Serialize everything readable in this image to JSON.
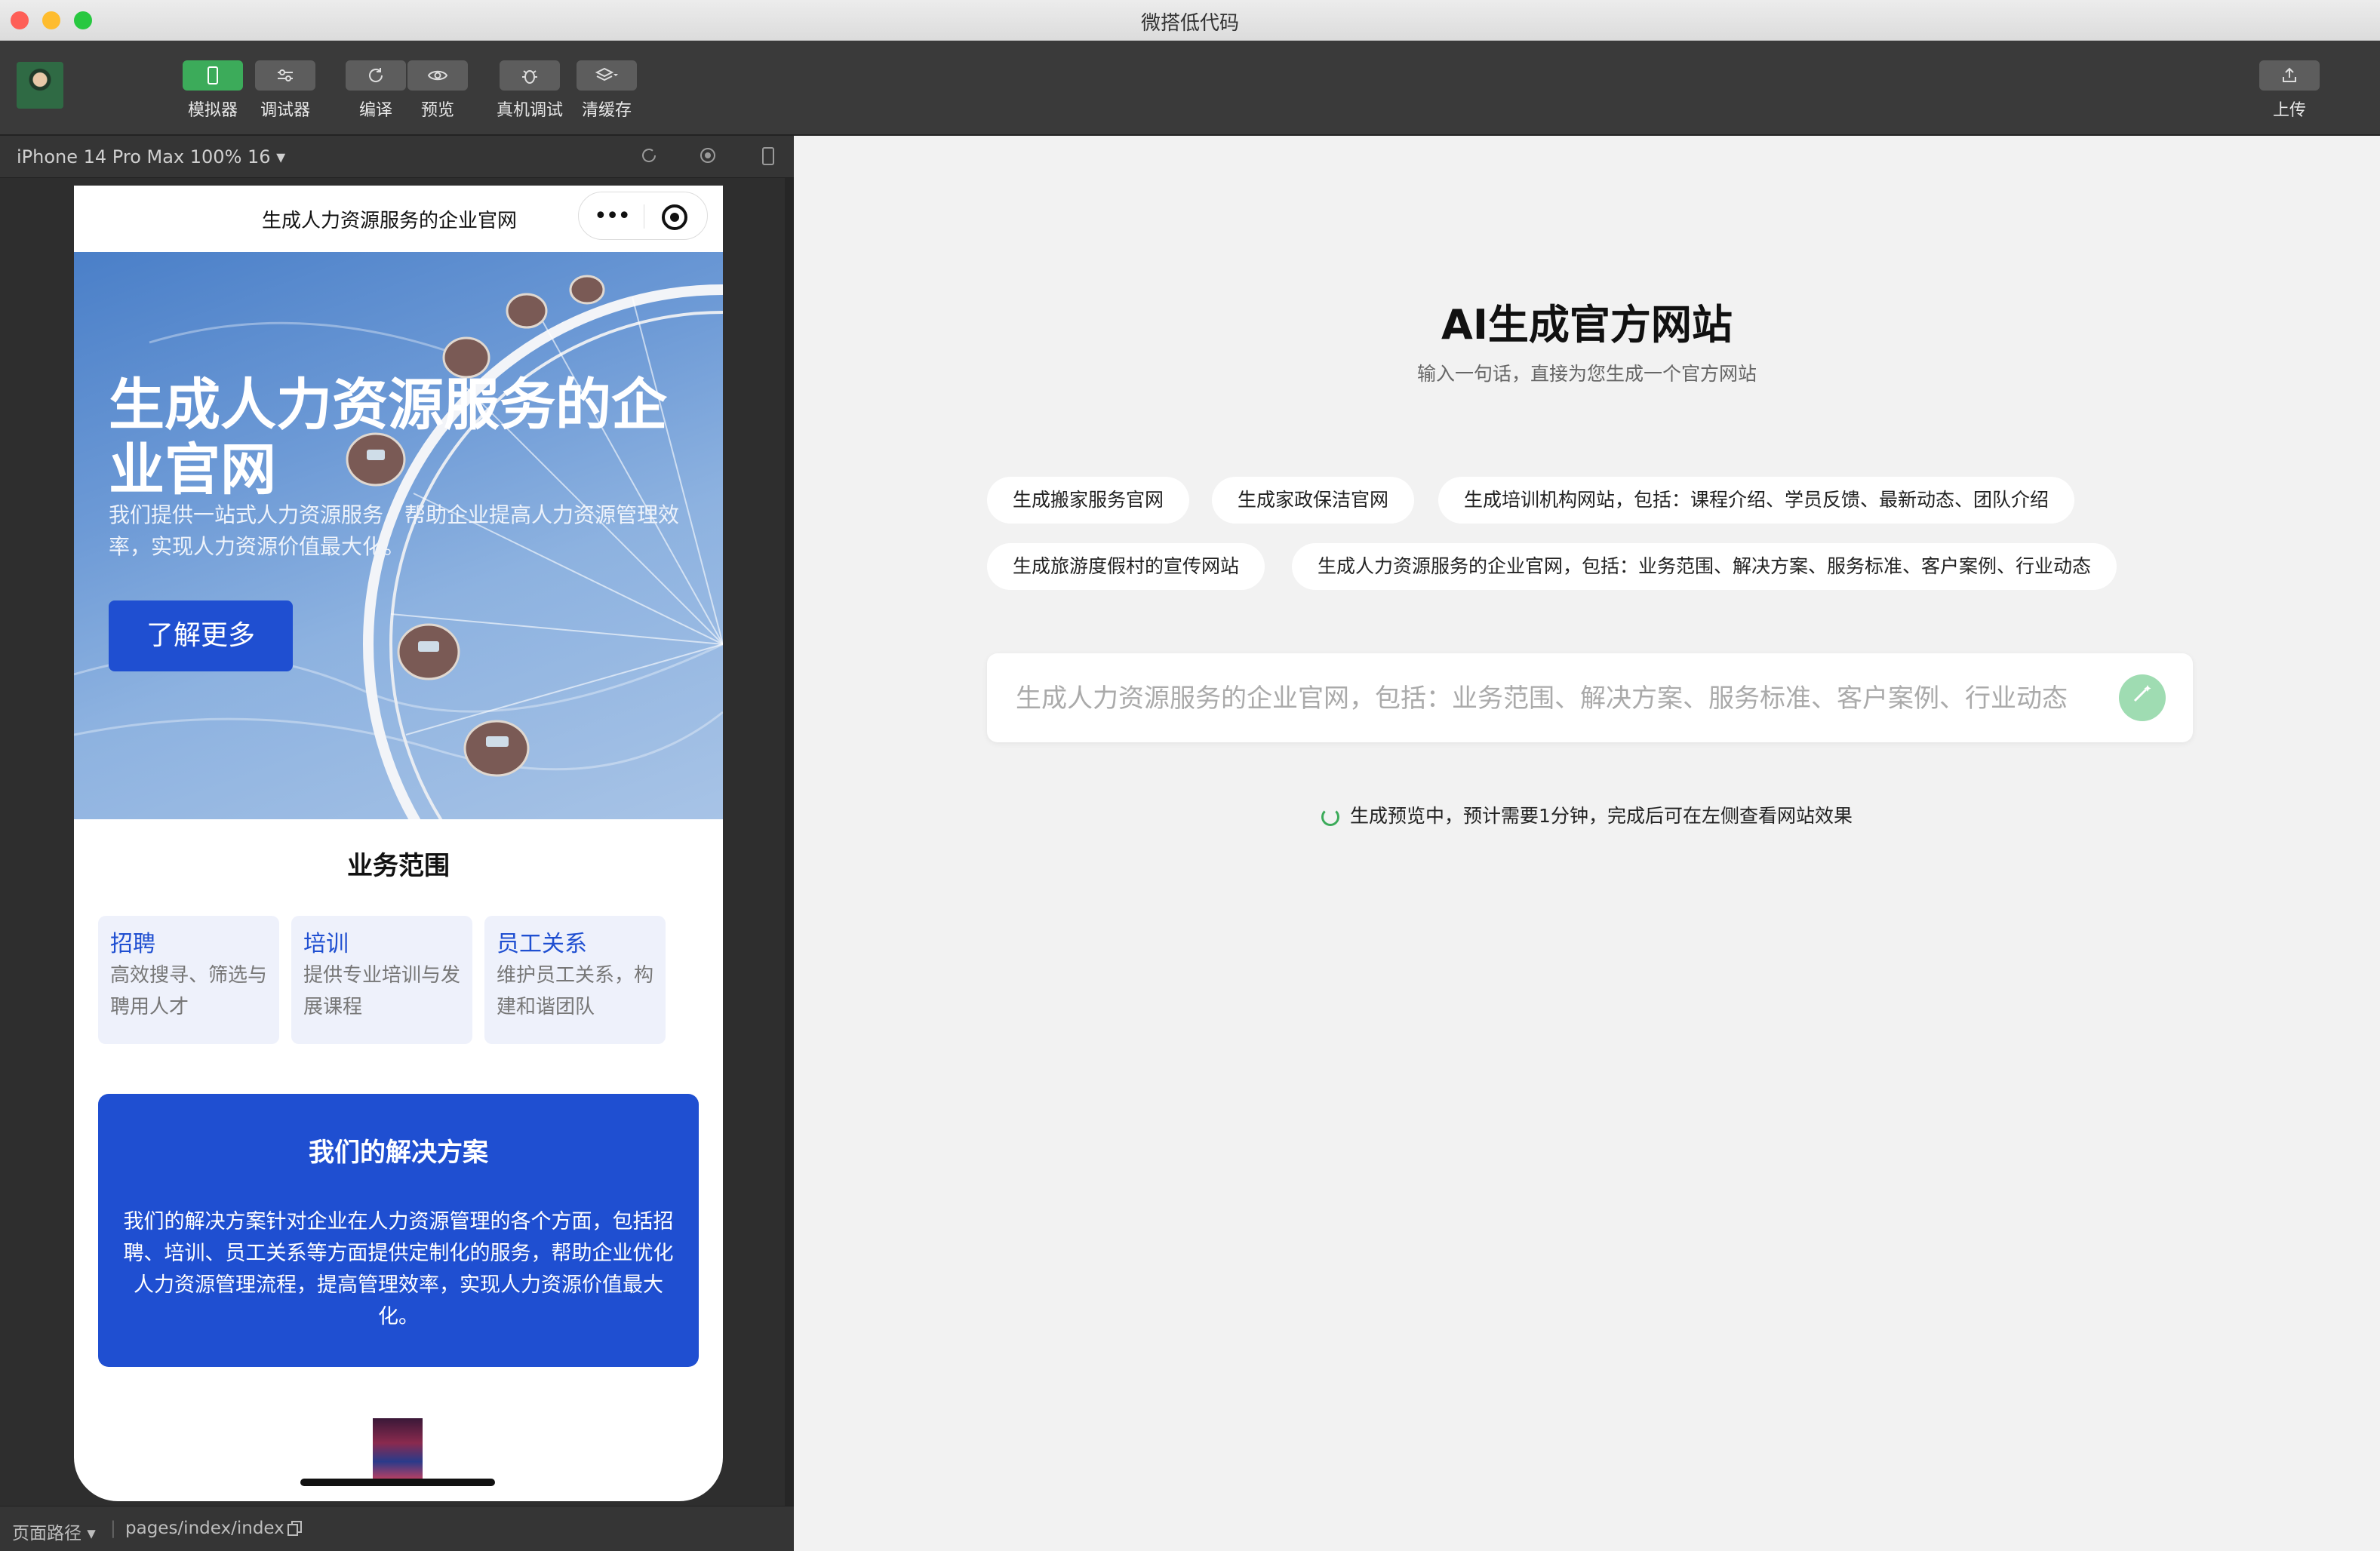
{
  "window": {
    "title": "微搭低代码"
  },
  "toolbar": {
    "simulator": "模拟器",
    "debugger": "调试器",
    "compile": "编译",
    "preview": "预览",
    "device_debug": "真机调试",
    "clear_cache": "清缓存",
    "upload": "上传"
  },
  "device": {
    "label": "iPhone 14 Pro Max 100% 16 ▾"
  },
  "statusbar": {
    "path_label": "页面路径 ▾",
    "path_value": "pages/index/index"
  },
  "phone": {
    "nav_title": "生成人力资源服务的企业官网",
    "hero": {
      "title": "生成人力资源服务的企业官网",
      "description": "我们提供一站式人力资源服务，帮助企业提高人力资源管理效率，实现人力资源价值最大化。",
      "button": "了解更多"
    },
    "section_title": "业务范围",
    "cards": [
      {
        "title": "招聘",
        "desc": "高效搜寻、筛选与聘用人才"
      },
      {
        "title": "培训",
        "desc": "提供专业培训与发展课程"
      },
      {
        "title": "员工关系",
        "desc": "维护员工关系，构建和谐团队"
      }
    ],
    "solution": {
      "title": "我们的解决方案",
      "text": "我们的解决方案针对企业在人力资源管理的各个方面，包括招聘、培训、员工关系等方面提供定制化的服务，帮助企业优化人力资源管理流程，提高管理效率，实现人力资源价值最大化。"
    }
  },
  "generator": {
    "title": "AI生成官方网站",
    "subtitle": "输入一句话，直接为您生成一个官方网站",
    "chips": [
      "生成搬家服务官网",
      "生成家政保洁官网",
      "生成培训机构网站，包括：课程介绍、学员反馈、最新动态、团队介绍",
      "生成旅游度假村的宣传网站",
      "生成人力资源服务的企业官网，包括：业务范围、解决方案、服务标准、客户案例、行业动态"
    ],
    "input_placeholder": "生成人力资源服务的企业官网，包括：业务范围、解决方案、服务标准、客户案例、行业动态",
    "status": "生成预览中，预计需要1分钟，完成后可在左侧查看网站效果"
  },
  "colors": {
    "accent_green": "#3cab5a",
    "brand_blue": "#1f4fd1"
  },
  "icons": {
    "simulator": "phone-icon",
    "debugger": "sliders-icon",
    "compile": "refresh-icon",
    "preview": "eye-icon",
    "device_debug": "bug-icon",
    "clear_cache": "layers-icon",
    "upload": "upload-icon",
    "send": "magic-wand-icon"
  }
}
